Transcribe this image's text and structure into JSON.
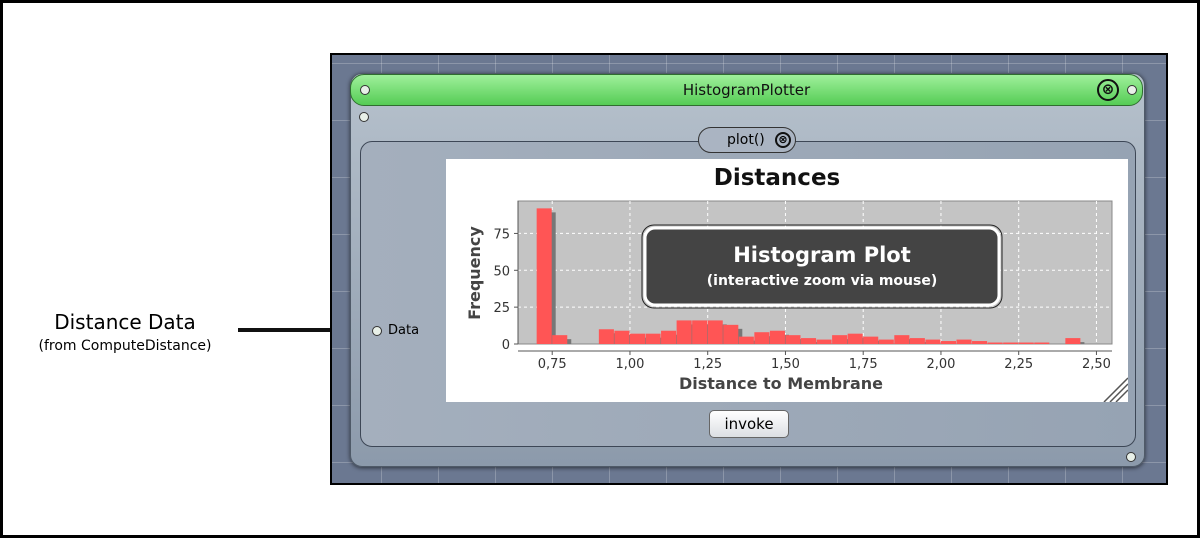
{
  "annotation": {
    "title": "Distance Data",
    "subtitle": "(from ComputeDistance)"
  },
  "window": {
    "title": "HistogramPlotter",
    "close_symbol": "⊗",
    "method_label": "plot()",
    "input_port_label": "Data",
    "invoke_label": "invoke",
    "title_bar_color": "#66d966"
  },
  "overlay": {
    "title": "Histogram Plot",
    "subtitle": "(interactive zoom via mouse)"
  },
  "chart_data": {
    "type": "bar",
    "title": "Distances",
    "xlabel": "Distance to Membrane",
    "ylabel": "Frequency",
    "xticks": [
      "0,75",
      "1,00",
      "1,25",
      "1,50",
      "1,75",
      "2,00",
      "2,25",
      "2,50"
    ],
    "yticks": [
      "0",
      "25",
      "50",
      "75"
    ],
    "xlim": [
      0.64,
      2.55
    ],
    "ylim": [
      0,
      97
    ],
    "bin_width": 0.05,
    "bar_color": "#ff5555",
    "shadow_color": "#777777",
    "plot_bg": "#c4c4c4",
    "bins": [
      {
        "x": 0.7,
        "y": 92
      },
      {
        "x": 0.75,
        "y": 6
      },
      {
        "x": 0.9,
        "y": 10
      },
      {
        "x": 0.95,
        "y": 9
      },
      {
        "x": 1.0,
        "y": 7
      },
      {
        "x": 1.05,
        "y": 7
      },
      {
        "x": 1.1,
        "y": 9
      },
      {
        "x": 1.15,
        "y": 16
      },
      {
        "x": 1.2,
        "y": 16
      },
      {
        "x": 1.25,
        "y": 16
      },
      {
        "x": 1.3,
        "y": 13
      },
      {
        "x": 1.35,
        "y": 5
      },
      {
        "x": 1.4,
        "y": 8
      },
      {
        "x": 1.45,
        "y": 9
      },
      {
        "x": 1.5,
        "y": 6
      },
      {
        "x": 1.55,
        "y": 4
      },
      {
        "x": 1.6,
        "y": 3
      },
      {
        "x": 1.65,
        "y": 6
      },
      {
        "x": 1.7,
        "y": 7
      },
      {
        "x": 1.75,
        "y": 5
      },
      {
        "x": 1.8,
        "y": 3
      },
      {
        "x": 1.85,
        "y": 6
      },
      {
        "x": 1.9,
        "y": 4
      },
      {
        "x": 1.95,
        "y": 3
      },
      {
        "x": 2.0,
        "y": 2
      },
      {
        "x": 2.05,
        "y": 3
      },
      {
        "x": 2.1,
        "y": 2
      },
      {
        "x": 2.15,
        "y": 1
      },
      {
        "x": 2.2,
        "y": 1
      },
      {
        "x": 2.25,
        "y": 1
      },
      {
        "x": 2.3,
        "y": 1
      },
      {
        "x": 2.4,
        "y": 4
      }
    ]
  }
}
